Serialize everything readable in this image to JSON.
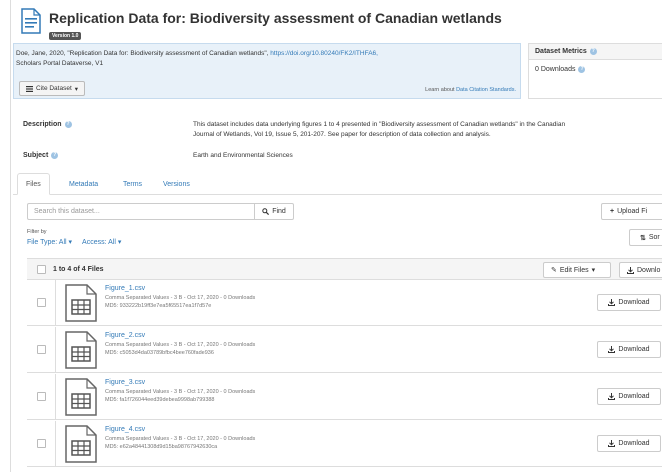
{
  "dataset": {
    "title": "Replication Data for: Biodiversity assessment of Canadian wetlands",
    "version": "Version 1.0"
  },
  "citation": {
    "text": "Doe, Jane, 2020, \"Replication Data for: Biodiversity assessment of Canadian wetlands\",",
    "doi": "https://doi.org/10.80240/FK2/ITHFA6,",
    "text2": "Scholars Portal Dataverse, V1",
    "cite_button": "Cite Dataset",
    "learn_prefix": "Learn about",
    "learn_link": "Data Citation Standards."
  },
  "metrics": {
    "title": "Dataset Metrics",
    "downloads": "0 Downloads"
  },
  "metadata": {
    "description_label": "Description",
    "description_line1": "This dataset includes data underlying figures 1 to 4 presented in \"Biodiversity assessment of Canadian wetlands\" in the Canadian",
    "description_line2": "Journal of Wetlands, Vol 19, Issue 5, 201-207. See paper for description of data collection and analysis.",
    "subject_label": "Subject",
    "subject_value": "Earth and Environmental Sciences"
  },
  "tabs": [
    "Files",
    "Metadata",
    "Terms",
    "Versions"
  ],
  "toolbar": {
    "search_placeholder": "Search this dataset...",
    "find_label": "Find",
    "upload_label": "Upload Fi",
    "filter_by": "Filter by",
    "file_type": "File Type: All",
    "access": "Access: All",
    "sort_label": "Sor"
  },
  "files_header": {
    "count": "1 to 4 of 4 Files",
    "edit_label": "Edit Files",
    "download_label": "Downlo"
  },
  "files": [
    {
      "name": "Figure_1.csv",
      "desc": "Comma Separated Values - 3 B - Oct 17, 2020 - 0 Downloads",
      "md5": "MD5: 933222b19ff3e7ea5f65517ea1f7d57e",
      "download": "Download"
    },
    {
      "name": "Figure_2.csv",
      "desc": "Comma Separated Values - 3 B - Oct 17, 2020 - 0 Downloads",
      "md5": "MD5: c5053d4da03789bfbc4bee760fade936",
      "download": "Download"
    },
    {
      "name": "Figure_3.csv",
      "desc": "Comma Separated Values - 3 B - Oct 17, 2020 - 0 Downloads",
      "md5": "MD5: fa1f726044eed39debea9998ab799388",
      "download": "Download"
    },
    {
      "name": "Figure_4.csv",
      "desc": "Comma Separated Values - 3 B - Oct 17, 2020 - 0 Downloads",
      "md5": "MD5: e62a48441308d9d15ba98767942630ca",
      "download": "Download"
    }
  ],
  "icons": {
    "dataset": "document-icon",
    "help": "question-circle-icon",
    "cite": "list-icon",
    "search": "search-icon",
    "upload": "plus-icon",
    "sort": "sort-icon",
    "edit": "pencil-icon",
    "download": "download-icon",
    "file": "spreadsheet-icon",
    "caret": "caret-down-icon"
  },
  "colors": {
    "link": "#337ab7",
    "citation_bg": "#e8f1f9",
    "version_badge": "#555555"
  }
}
